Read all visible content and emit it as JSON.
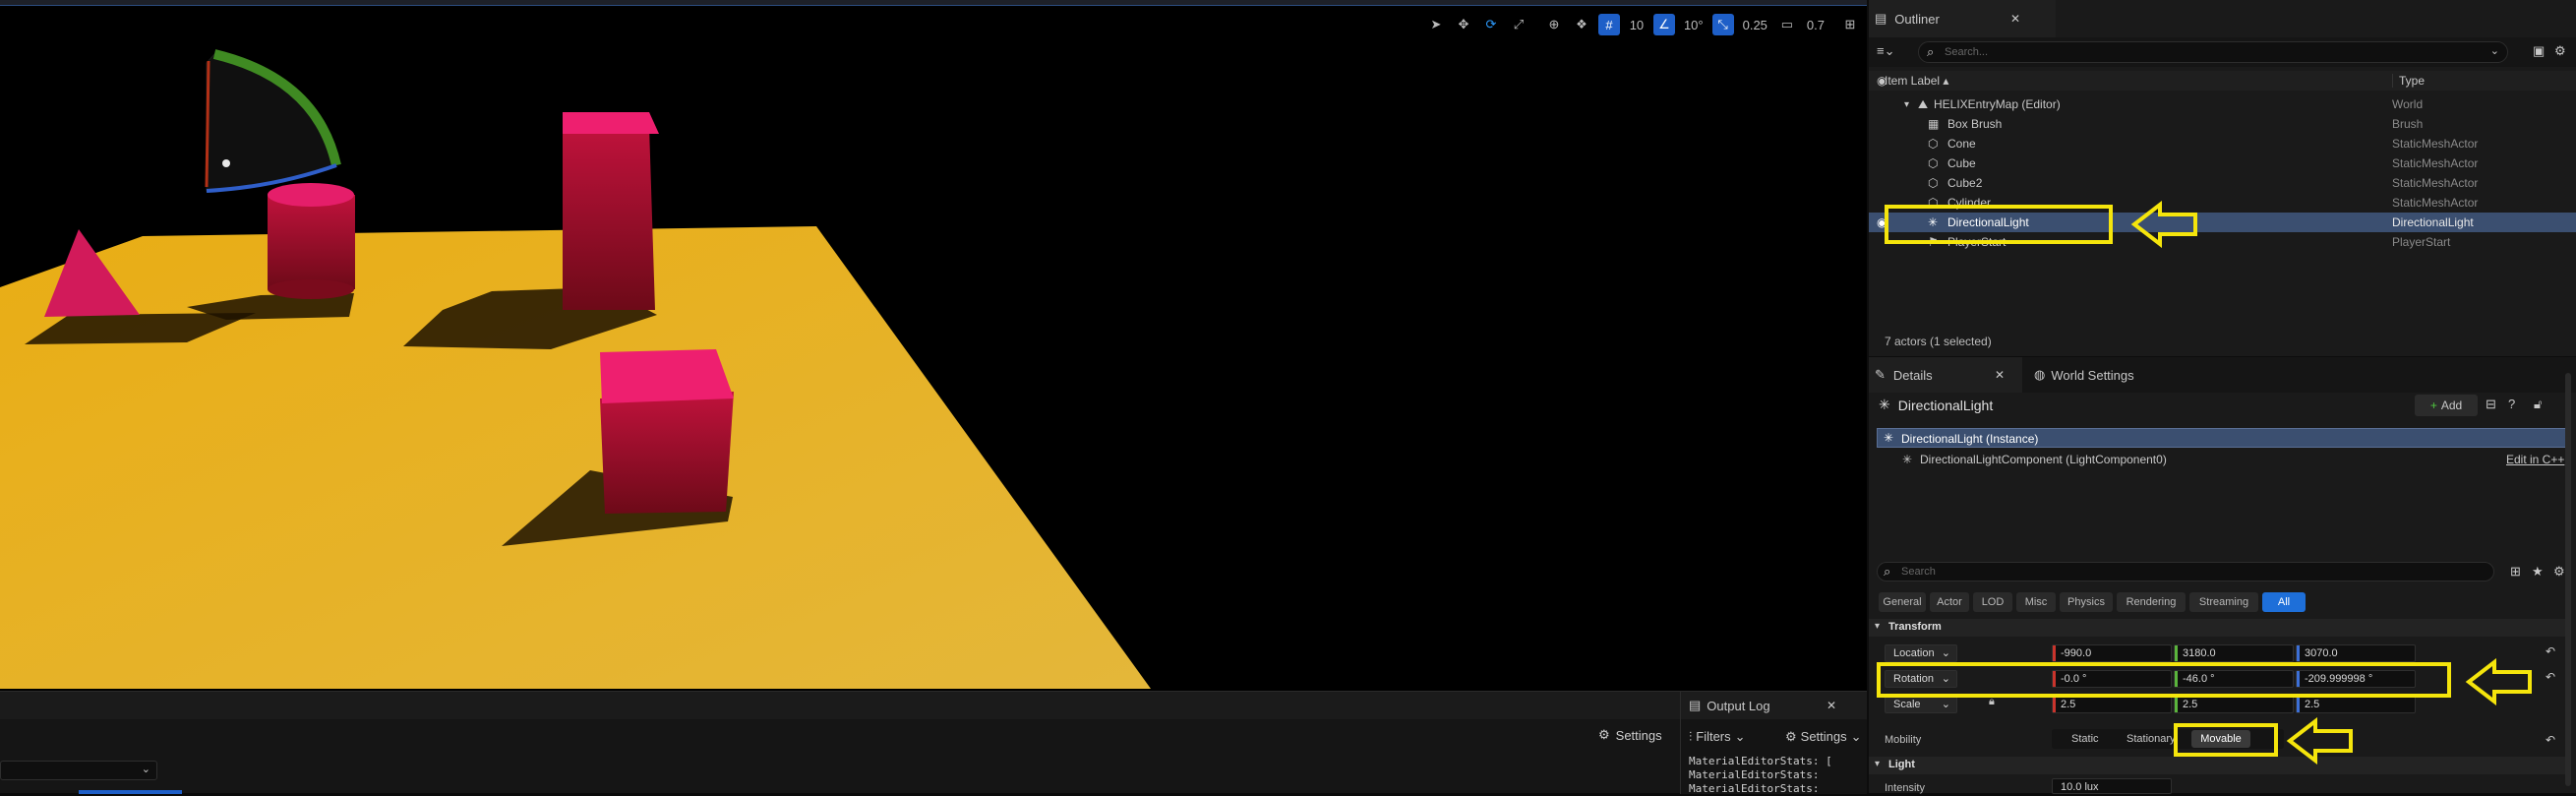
{
  "viewport": {
    "toolbar": {
      "grid_value": "10",
      "rotation_snap": "10°",
      "scale_snap": "0.25",
      "camera_speed": "0.7"
    }
  },
  "outliner": {
    "tab_label": "Outliner",
    "search_placeholder": "Search...",
    "col_label": "Item Label ▴",
    "col_type": "Type",
    "rows": [
      {
        "label": "HELIXEntryMap (Editor)",
        "type": "World"
      },
      {
        "label": "Box Brush",
        "type": "Brush"
      },
      {
        "label": "Cone",
        "type": "StaticMeshActor"
      },
      {
        "label": "Cube",
        "type": "StaticMeshActor"
      },
      {
        "label": "Cube2",
        "type": "StaticMeshActor"
      },
      {
        "label": "Cylinder",
        "type": "StaticMeshActor"
      },
      {
        "label": "DirectionalLight",
        "type": "DirectionalLight"
      },
      {
        "label": "PlayerStart",
        "type": "PlayerStart"
      }
    ],
    "status": "7 actors (1 selected)"
  },
  "details": {
    "tab_label": "Details",
    "world_settings_label": "World Settings",
    "actor_name": "DirectionalLight",
    "add_label": "Add",
    "instance_label": "DirectionalLight (Instance)",
    "component_label": "DirectionalLightComponent (LightComponent0)",
    "edit_cpp": "Edit in C++",
    "search_placeholder": "Search",
    "categories": [
      "General",
      "Actor",
      "LOD",
      "Misc",
      "Physics",
      "Rendering",
      "Streaming",
      "All"
    ],
    "transform_label": "Transform",
    "location_label": "Location",
    "rotation_label": "Rotation",
    "scale_label": "Scale",
    "location": [
      "-990.0",
      "3180.0",
      "3070.0"
    ],
    "rotation": [
      "-0.0 °",
      "-46.0 °",
      "-209.999998 °"
    ],
    "scale": [
      "2.5",
      "2.5",
      "2.5"
    ],
    "mobility_label": "Mobility",
    "mobility_options": [
      "Static",
      "Stationary",
      "Movable"
    ],
    "light_label": "Light",
    "intensity_label": "Intensity",
    "intensity_value": "10.0 lux"
  },
  "output_log": {
    "tab_label": "Output Log",
    "filters_label": "Filters",
    "settings_label": "Settings",
    "lines": [
      "MaterialEditorStats: [",
      "MaterialEditorStats: ",
      "MaterialEditorStats: "
    ]
  },
  "bottom": {
    "settings_label": "Settings"
  },
  "colors": {
    "accent": "#2d9cff",
    "highlight": "#f5e50c",
    "floor": "#efb520",
    "mesh": "#e0135f",
    "selection": "#3b4f70"
  }
}
